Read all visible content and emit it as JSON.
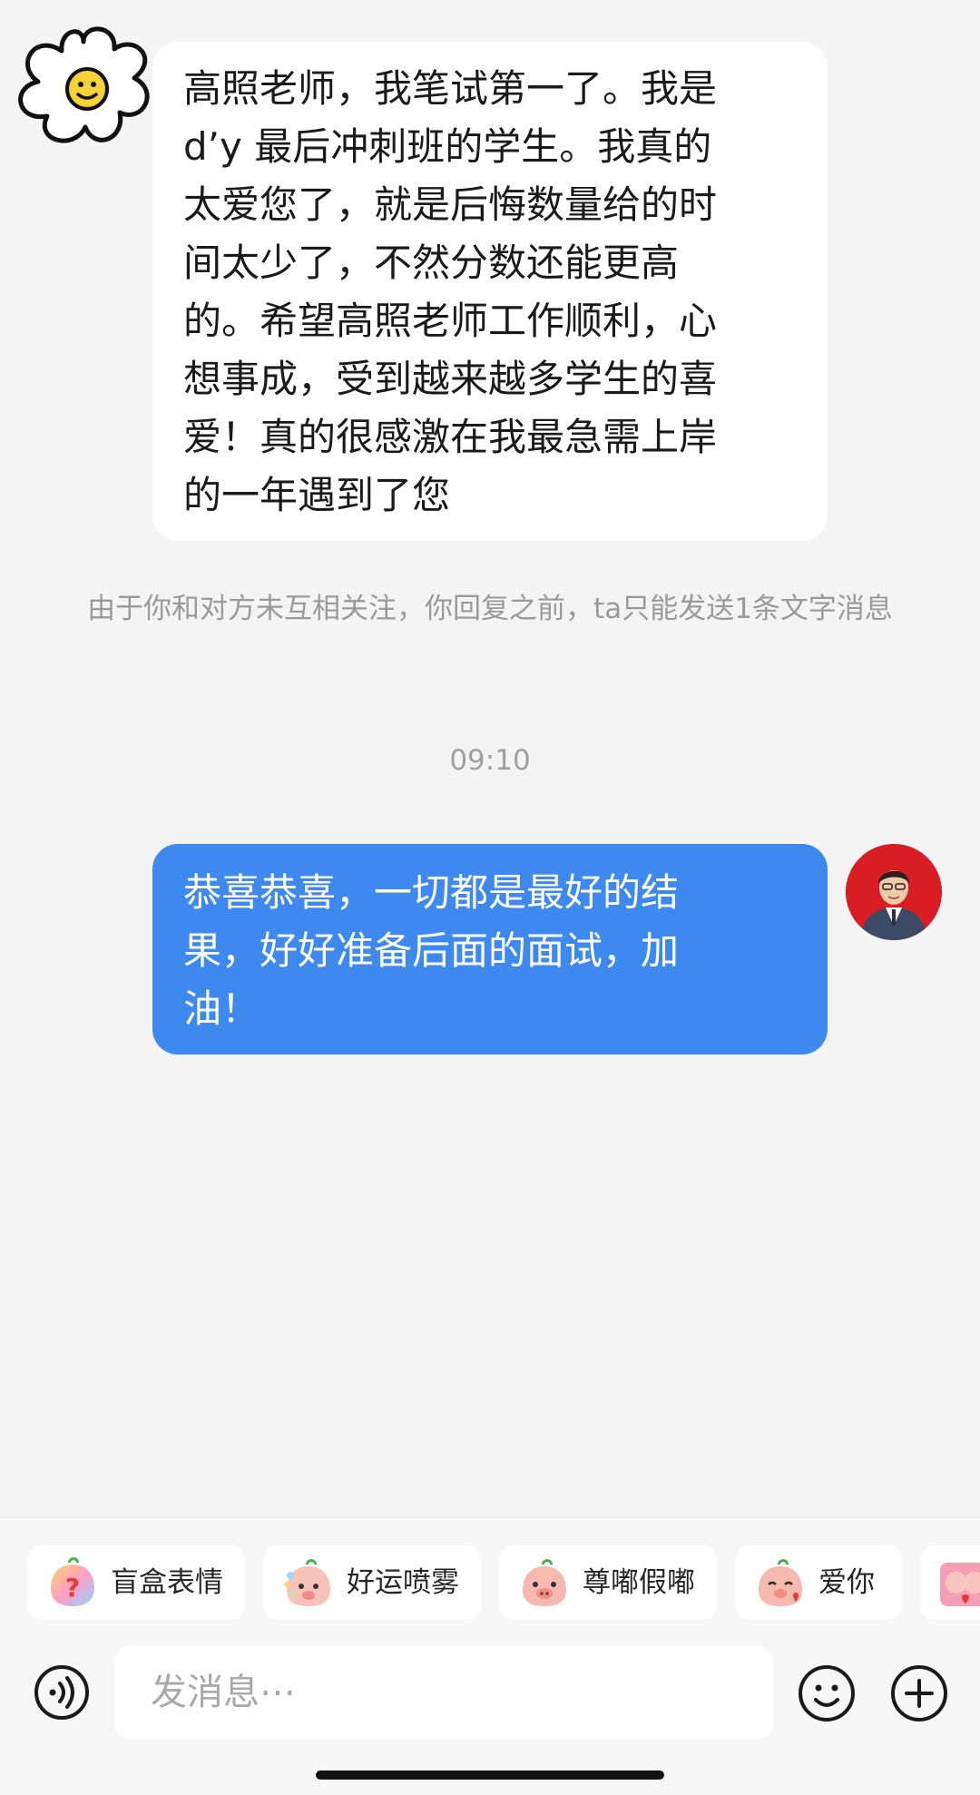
{
  "conversation": {
    "incoming_message": "高照老师，我笔试第一了。我是\nd’y 最后冲刺班的学生。我真的\n太爱您了，就是后悔数量给的时\n间太少了，不然分数还能更高\n的。希望高照老师工作顺利，心\n想事成，受到越来越多学生的喜\n爱！真的很感激在我最急需上岸\n的一年遇到了您",
    "notice": "由于你和对方未互相关注，你回复之前，ta只能发送1条文字消息",
    "timestamp": "09:10",
    "outgoing_message": "恭喜恭喜，一切都是最好的结\n果，好好准备后面的面试，加\n油！"
  },
  "stickers": [
    {
      "label": "盲盒表情",
      "icon": "mystery-box-sticker-icon"
    },
    {
      "label": "好运喷雾",
      "icon": "lucky-spray-sticker-icon"
    },
    {
      "label": "尊嘟假嘟",
      "icon": "pig-face-sticker-icon"
    },
    {
      "label": "爱你",
      "icon": "love-you-sticker-icon"
    }
  ],
  "composer": {
    "placeholder": "发消息⋯"
  },
  "colors": {
    "outgoing_bubble": "#3d89ef",
    "incoming_bubble": "#ffffff",
    "background": "#f4f4f4",
    "teacher_avatar_bg": "#d81e24"
  }
}
